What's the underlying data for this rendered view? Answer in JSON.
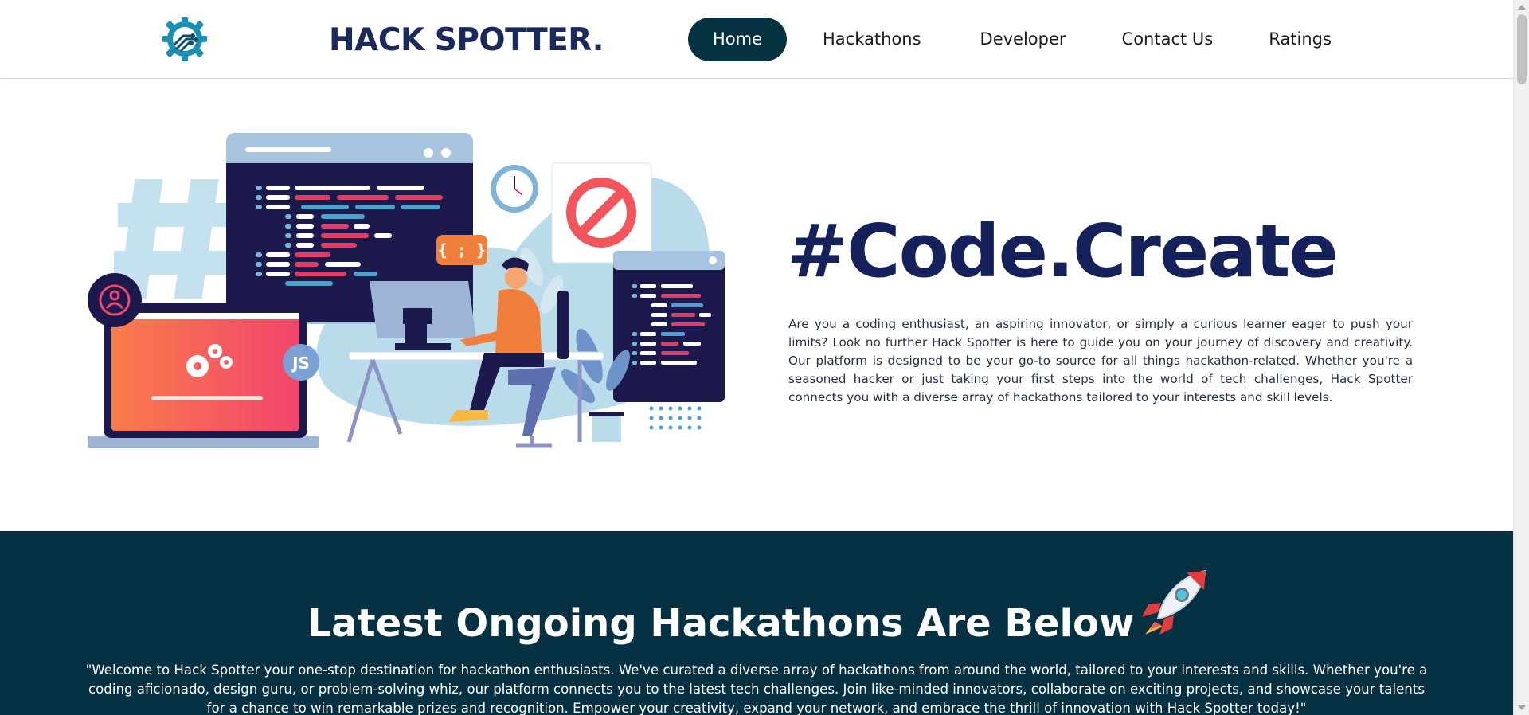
{
  "header": {
    "brand": "HACK SPOTTER.",
    "logo_icon": "gear-circuit-icon",
    "nav": [
      {
        "label": "Home",
        "active": true
      },
      {
        "label": "Hackathons",
        "active": false
      },
      {
        "label": "Developer",
        "active": false
      },
      {
        "label": "Contact Us",
        "active": false
      },
      {
        "label": "Ratings",
        "active": false
      }
    ]
  },
  "hero": {
    "title": "#Code.Create",
    "text": "Are you a coding enthusiast, an aspiring innovator, or simply a curious learner eager to push your limits? Look no further Hack Spotter is here to guide you on your journey of discovery and creativity. Our platform is designed to be your go-to source for all things hackathon-related. Whether you're a seasoned hacker or just taking your first steps into the world of tech challenges, Hack Spotter connects you with a diverse array of hackathons tailored to your interests and skill levels.",
    "illustration_labels": {
      "js": "JS",
      "braces": "{ ; }",
      "hash": "#"
    }
  },
  "hackathons": {
    "title": "Latest Ongoing Hackathons Are Below",
    "title_icon": "rocket-icon",
    "text": "\"Welcome to Hack Spotter your one-stop destination for hackathon enthusiasts. We've curated a diverse array of hackathons from around the world, tailored to your interests and skills. Whether you're a coding aficionado, design guru, or problem-solving whiz, our platform connects you to the latest tech challenges. Join like-minded innovators, collaborate on exciting projects, and showcase your talents for a chance to win remarkable prizes and recognition. Empower your creativity, expand your network, and embrace the thrill of innovation with Hack Spotter today!\""
  },
  "colors": {
    "brand_navy": "#1b2a5c",
    "nav_active_bg": "#063241",
    "section_bg": "#053142",
    "hero_title": "#15215a"
  }
}
